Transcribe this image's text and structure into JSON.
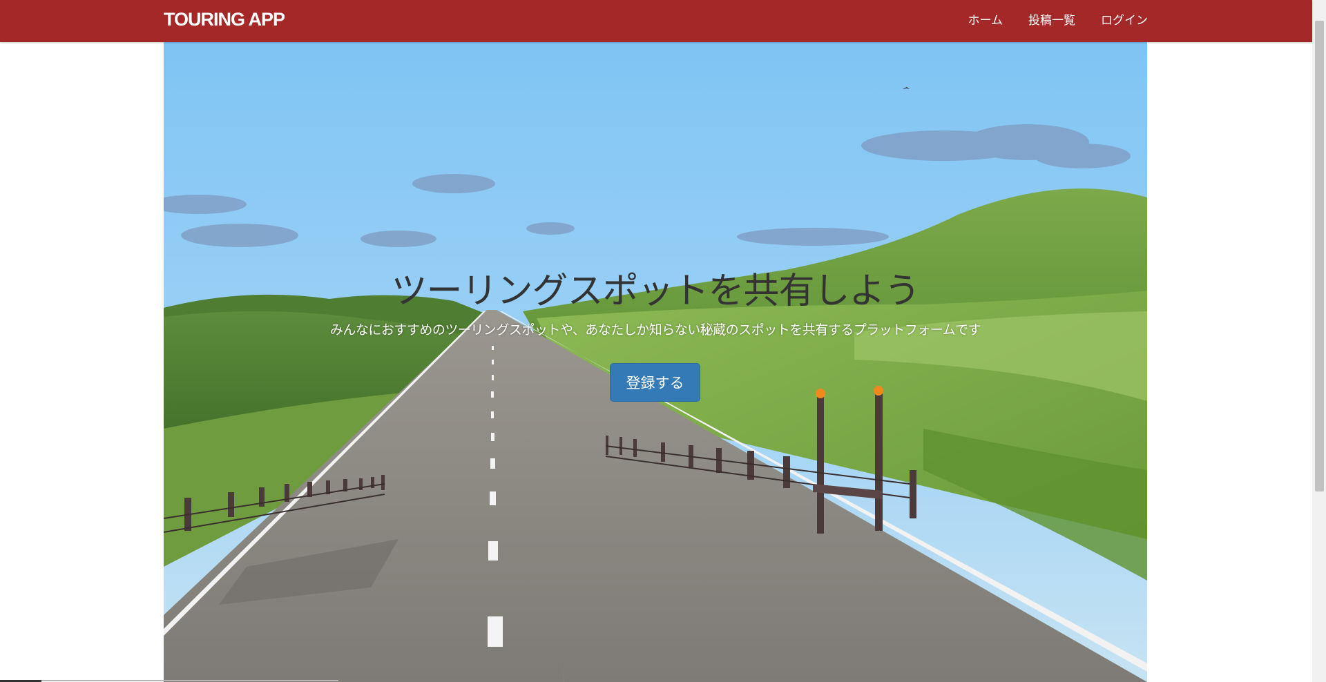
{
  "navbar": {
    "brand": "TOURING APP",
    "links": [
      {
        "label": "ホーム"
      },
      {
        "label": "投稿一覧"
      },
      {
        "label": "ログイン"
      }
    ]
  },
  "hero": {
    "title": "ツーリングスポットを共有しよう",
    "subtitle": "みんなにおすすめのツーリングスポットや、あなたしか知らない秘蔵のスポットを共有するプラットフォームです",
    "register_label": "登録する",
    "background": "road-landscape-photo"
  },
  "colors": {
    "navbar": "#a52828",
    "button": "#337ab7"
  }
}
